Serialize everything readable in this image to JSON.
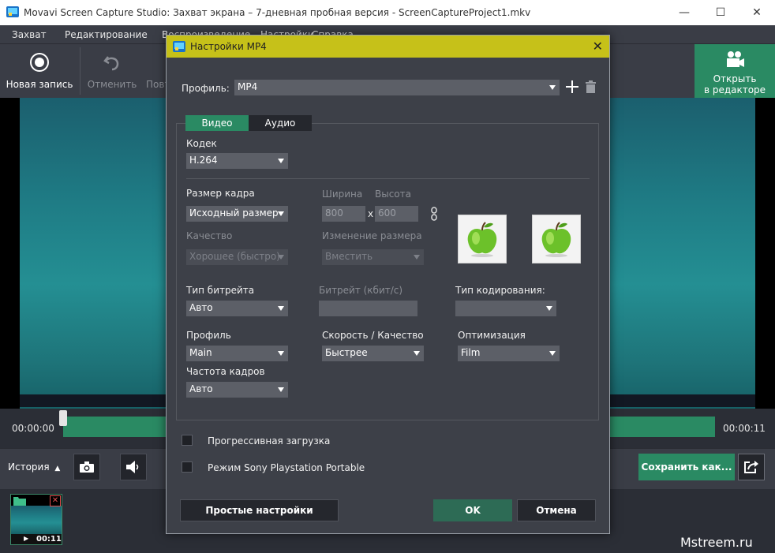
{
  "window": {
    "title": "Movavi Screen Capture Studio: Захват экрана – 7-дневная пробная версия - ScreenCaptureProject1.mkv",
    "minimize": "—",
    "maximize": "☐",
    "close": "✕"
  },
  "menu": [
    "Захват",
    "Редактирование",
    "Воспроизведение",
    "Настройки",
    "Справка"
  ],
  "toolbar": {
    "new_record": "Новая запись",
    "undo": "Отменить",
    "redo": "Повторить",
    "open_editor_line1": "Открыть",
    "open_editor_line2": "в редакторе"
  },
  "timeline": {
    "start": "00:00:00",
    "end": "00:00:11"
  },
  "bottom": {
    "history": "История",
    "save_as": "Сохранить как..."
  },
  "thumbnail": {
    "duration": "00:11"
  },
  "watermark": "Mstreem.ru",
  "dialog": {
    "title": "Настройки MP4",
    "close": "✕",
    "profile_label": "Профиль:",
    "profile_value": "MP4",
    "tabs": [
      "Видео",
      "Аудио"
    ],
    "codec_label": "Кодек",
    "codec_value": "H.264",
    "frame_size_label": "Размер кадра",
    "frame_size_value": "Исходный размер",
    "width_label": "Ширина",
    "height_label": "Высота",
    "width_value": "800",
    "height_value": "600",
    "x_sep": "x",
    "quality_label": "Качество",
    "quality_value": "Хорошее (быстро)",
    "resize_label": "Изменение размера",
    "resize_value": "Вместить",
    "bitrate_type_label": "Тип битрейта",
    "bitrate_type_value": "Авто",
    "bitrate_label": "Битрейт (кбит/с)",
    "bitrate_value": "",
    "encoding_type_label": "Тип кодирования:",
    "encoding_type_value": "",
    "profile2_label": "Профиль",
    "profile2_value": "Main",
    "speed_label": "Скорость / Качество",
    "speed_value": "Быстрее",
    "optimization_label": "Оптимизация",
    "optimization_value": "Film",
    "framerate_label": "Частота кадров",
    "framerate_value": "Авто",
    "progressive_label": "Прогрессивная загрузка",
    "psp_label": "Режим Sony Playstation Portable",
    "simple_btn": "Простые настройки",
    "ok_btn": "OK",
    "cancel_btn": "Отмена"
  },
  "colors": {
    "accent_green": "#2a8a63",
    "dialog_title": "#c6c119",
    "background": "#3a3d46"
  }
}
